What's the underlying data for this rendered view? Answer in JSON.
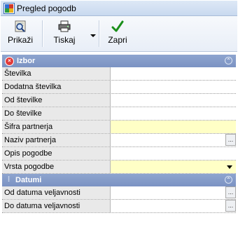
{
  "window": {
    "title": "Pregled pogodb"
  },
  "toolbar": {
    "buttons": [
      {
        "label": "Prikaži",
        "icon": "search-icon"
      },
      {
        "label": "Tiskaj",
        "icon": "printer-icon"
      },
      {
        "label": "Zapri",
        "icon": "checkmark-icon"
      }
    ]
  },
  "sections": [
    {
      "title": "Izbor",
      "icon": "section-close-icon",
      "fields": [
        {
          "label": "Številka",
          "value": ""
        },
        {
          "label": "Dodatna številka",
          "value": ""
        },
        {
          "label": "Od številke",
          "value": ""
        },
        {
          "label": "Do številke",
          "value": ""
        },
        {
          "label": "Šifra partnerja",
          "value": ""
        },
        {
          "label": "Naziv partnerja",
          "value": "",
          "button": "..."
        },
        {
          "label": "Opis pogodbe",
          "value": ""
        },
        {
          "label": "Vrsta pogodbe",
          "value": ""
        }
      ]
    },
    {
      "title": "Datumi",
      "icon": "dots-icon",
      "fields": [
        {
          "label": "Od datuma veljavnosti",
          "value": "",
          "button": "..."
        },
        {
          "label": "Do datuma veljavnosti",
          "value": "",
          "button": "..."
        }
      ]
    }
  ],
  "colors": {
    "section_header": "#7b93c3",
    "required_field": "#ffffc6",
    "label_bg": "#e9e9e9"
  }
}
